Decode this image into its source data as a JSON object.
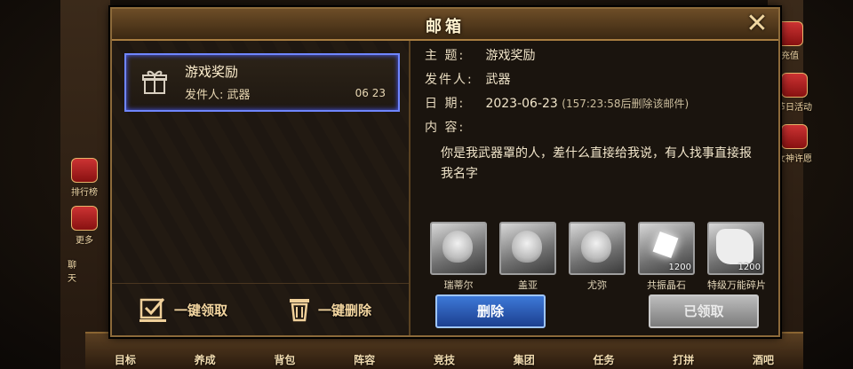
{
  "dialog": {
    "title": "邮箱",
    "close_icon": "close-icon"
  },
  "mail_list": [
    {
      "subject": "游戏奖励",
      "sender": "发件人: 武器",
      "date": "06 23",
      "icon": "gift-icon",
      "selected": true
    }
  ],
  "left_actions": {
    "claim_all": "一键领取",
    "delete_all": "一键删除"
  },
  "detail": {
    "subject_label": "主 题:",
    "subject": "游戏奖励",
    "sender_label": "发件人:",
    "sender": "武器",
    "date_label": "日 期:",
    "date": "2023-06-23",
    "expire_note": "(157:23:58后删除该邮件)",
    "content_label": "内 容:",
    "content": "你是我武器罩的人，差什么直接给我说，有人找事直接报我名字"
  },
  "attachments": [
    {
      "name": "瑞蒂尔",
      "qty": "",
      "kind": "portrait"
    },
    {
      "name": "盖亚",
      "qty": "",
      "kind": "portrait"
    },
    {
      "name": "尤弥",
      "qty": "",
      "kind": "portrait"
    },
    {
      "name": "共振晶石",
      "qty": "1200",
      "kind": "crystal"
    },
    {
      "name": "特级万能碎片",
      "qty": "1200",
      "kind": "puzzle"
    }
  ],
  "buttons": {
    "delete": "删除",
    "claimed": "已领取"
  },
  "background": {
    "left_side": [
      "排行榜",
      "更多",
      "聊天"
    ],
    "right_side": [
      "充值",
      "节日活动",
      "女神许愿"
    ],
    "bottom_bar": [
      "目标",
      "养成",
      "背包",
      "阵容",
      "竞技",
      "集团",
      "任务",
      "打拼",
      "酒吧"
    ]
  },
  "colors": {
    "selected_border": "#6f86ff",
    "delete_button": "#3d79d8",
    "claimed_button": "#9a9a9a",
    "frame_gold": "#8c6a3a"
  }
}
